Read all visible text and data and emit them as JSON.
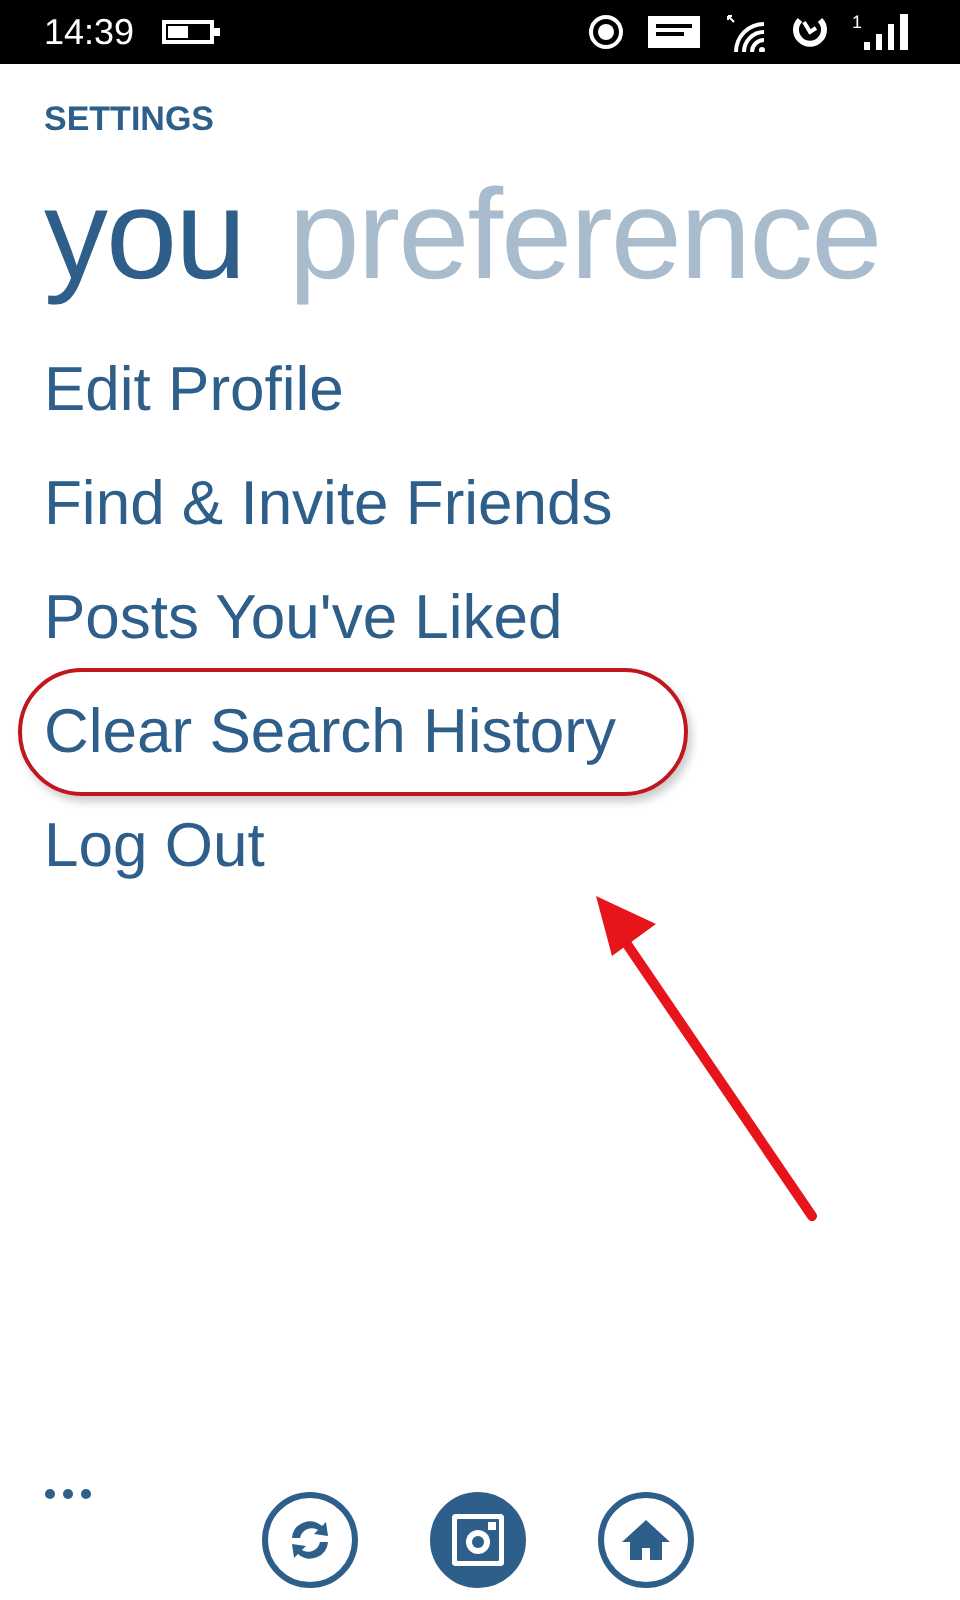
{
  "status_bar": {
    "time": "14:39",
    "sim_number": "1"
  },
  "header": "SETTINGS",
  "pivots": [
    {
      "label": "you",
      "selected": true
    },
    {
      "label": "preference",
      "selected": false
    }
  ],
  "menu": [
    {
      "label": "Edit Profile",
      "circled": false
    },
    {
      "label": "Find & Invite Friends",
      "circled": false
    },
    {
      "label": "Posts You've Liked",
      "circled": false
    },
    {
      "label": "Clear Search History",
      "circled": true
    },
    {
      "label": "Log Out",
      "circled": false
    }
  ],
  "app_bar": {
    "buttons": [
      {
        "kind": "sync",
        "selected": false
      },
      {
        "kind": "camera",
        "selected": true
      },
      {
        "kind": "home",
        "selected": false
      }
    ]
  }
}
